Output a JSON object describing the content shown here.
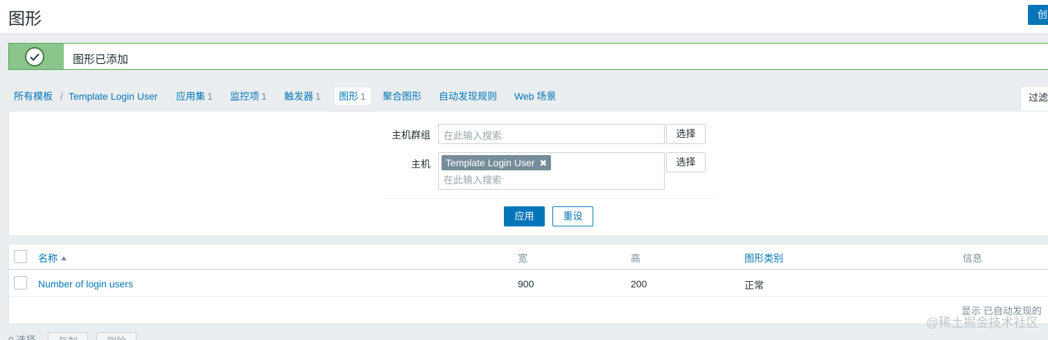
{
  "header": {
    "title": "图形",
    "create_button": "创"
  },
  "message": {
    "text": "图形已添加"
  },
  "breadcrumb": {
    "all_templates": "所有模板",
    "separator": "/",
    "template": "Template Login User",
    "tabs": [
      {
        "label": "应用集",
        "count": "1"
      },
      {
        "label": "监控项",
        "count": "1"
      },
      {
        "label": "触发器",
        "count": "1"
      },
      {
        "label": "图形",
        "count": "1"
      },
      {
        "label": "聚合图形",
        "count": ""
      },
      {
        "label": "自动发现规则",
        "count": ""
      },
      {
        "label": "Web 场景",
        "count": ""
      }
    ]
  },
  "filter": {
    "tab_label": "过滤",
    "host_group_label": "主机群组",
    "host_group_placeholder": "在此输入搜索",
    "host_label": "主机",
    "host_tag": "Template Login User",
    "host_placeholder": "在此输入搜索",
    "select_label": "选择",
    "apply_label": "应用",
    "reset_label": "重设"
  },
  "table": {
    "columns": [
      "名称",
      "宽",
      "高",
      "图形类别",
      "信息"
    ],
    "rows": [
      {
        "name": "Number of login users",
        "width": "900",
        "height": "200",
        "type": "正常",
        "info": ""
      }
    ],
    "display_info": "显示 已自动发现的"
  },
  "footer": {
    "selected": "0 选择",
    "copy_label": "复制",
    "delete_label": "删除"
  },
  "watermark": "@稀土掘金技术社区",
  "colors": {
    "accent": "#0275b8",
    "success": "#8cc58c",
    "tag": "#768d99"
  }
}
